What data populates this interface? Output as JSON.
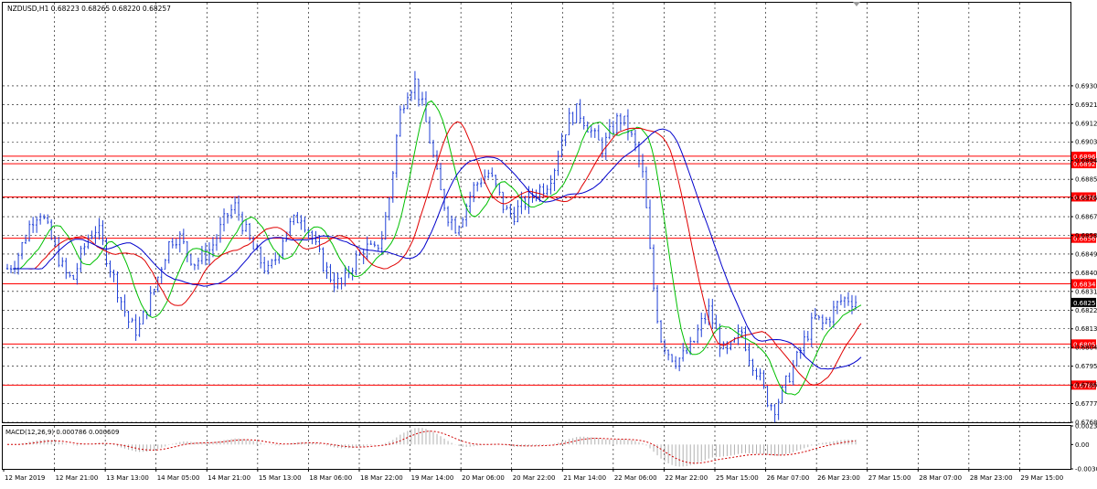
{
  "header": {
    "symbol_info": "NZDUSD,H1  0.68223 0.68265 0.68220 0.68257",
    "macd_info": "MACD(12,26,9) 0.000786 0.000609"
  },
  "colors": {
    "background": "#ffffff",
    "grid": "#000000",
    "candles": "#1f3fd6",
    "level_line": "#ff0000",
    "ma_green": "#00c000",
    "ma_red": "#e00000",
    "ma_blue": "#0000cc",
    "macd_hist": "#b0b0b0",
    "macd_signal": "#d00000",
    "price_tag": "#000000"
  },
  "chart_data": [
    {
      "type": "candlestick",
      "symbol": "NZDUSD",
      "timeframe": "H1",
      "ylim": [
        0.6768,
        0.697
      ],
      "price_ticks": [
        "0.69300",
        "0.69210",
        "0.69120",
        "0.69030",
        "0.68940",
        "0.68850",
        "0.68760",
        "0.68670",
        "0.68580",
        "0.68490",
        "0.68400",
        "0.68310",
        "0.68220",
        "0.68130",
        "0.68040",
        "0.67950",
        "0.67860",
        "0.67770",
        "0.67680"
      ],
      "current_price": 0.68257,
      "current_price_label": "0.68257",
      "levels": [
        {
          "value": 0.68925,
          "label": "0.68925"
        },
        {
          "value": 0.68961,
          "label": "0.68961"
        },
        {
          "value": 0.68765,
          "label": "0.68765"
        },
        {
          "value": 0.68566,
          "label": "0.68566"
        },
        {
          "value": 0.68347,
          "label": "0.68347"
        },
        {
          "value": 0.68057,
          "label": "0.68057"
        },
        {
          "value": 0.67859,
          "label": "0.67859"
        }
      ],
      "moving_averages": [
        "green",
        "red",
        "blue"
      ],
      "grid": true
    },
    {
      "type": "macd",
      "title": "MACD(12,26,9) 0.000786 0.000609",
      "ylim": [
        -0.00307,
        0.00234
      ],
      "ticks": [
        "0.00234",
        "0.00",
        "-0.00307"
      ]
    }
  ],
  "x_axis": {
    "labels": [
      "12 Mar 2019",
      "12 Mar 21:00",
      "13 Mar 13:00",
      "14 Mar 05:00",
      "14 Mar 21:00",
      "15 Mar 13:00",
      "18 Mar 06:00",
      "18 Mar 22:00",
      "19 Mar 14:00",
      "20 Mar 06:00",
      "20 Mar 22:00",
      "21 Mar 14:00",
      "22 Mar 06:00",
      "22 Mar 22:00",
      "25 Mar 15:00",
      "26 Mar 07:00",
      "26 Mar 23:00",
      "27 Mar 15:00",
      "28 Mar 07:00",
      "28 Mar 23:00",
      "29 Mar 15:00"
    ]
  },
  "series_path": [
    [
      0.6842,
      0.6846,
      0.6855,
      0.6866,
      0.687,
      0.686,
      0.685,
      0.684,
      0.6836,
      0.6848,
      0.6858,
      0.6862,
      0.685,
      0.6838,
      0.6826,
      0.6815,
      0.6812,
      0.6822,
      0.6832,
      0.6845,
      0.6856,
      0.6858,
      0.685,
      0.6845,
      0.6848,
      0.6852,
      0.686,
      0.6868,
      0.6872,
      0.6862,
      0.6852,
      0.6846,
      0.684,
      0.6848,
      0.686,
      0.6864,
      0.6868,
      0.686,
      0.685,
      0.6842,
      0.6836,
      0.6834,
      0.6842,
      0.6848,
      0.6852,
      0.685,
      0.6858,
      0.688,
      0.6915,
      0.6928,
      0.6932,
      0.6918,
      0.69,
      0.688,
      0.6868,
      0.6862,
      0.687,
      0.688,
      0.6885,
      0.6888,
      0.688,
      0.687,
      0.6868,
      0.6872,
      0.6876,
      0.688,
      0.6882,
      0.689,
      0.6905,
      0.6915,
      0.6918,
      0.6912,
      0.6905,
      0.69,
      0.6908,
      0.6915,
      0.691,
      0.69,
      0.6885,
      0.684,
      0.681,
      0.6802,
      0.6798,
      0.68,
      0.6805,
      0.6815,
      0.6822,
      0.681,
      0.68,
      0.6805,
      0.6812,
      0.68,
      0.6792,
      0.678,
      0.6775,
      0.6782,
      0.6792,
      0.68,
      0.681,
      0.6818,
      0.6815,
      0.682,
      0.6826,
      0.6828,
      0.6826
    ]
  ]
}
